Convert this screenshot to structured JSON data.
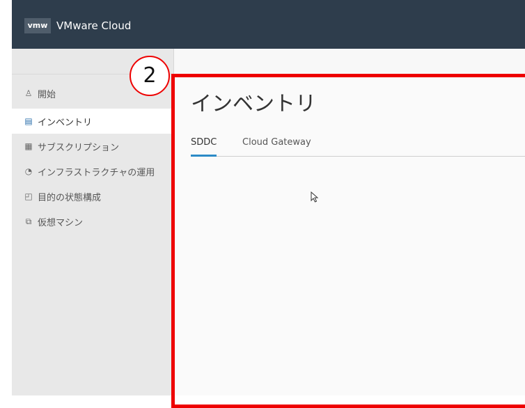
{
  "header": {
    "logo_text": "vmw",
    "app_title": "VMware Cloud"
  },
  "sidebar": {
    "items": [
      {
        "label": "開始",
        "icon": "user-icon"
      },
      {
        "label": "インベントリ",
        "icon": "inventory-icon",
        "active": true
      },
      {
        "label": "サブスクリプション",
        "icon": "calendar-icon"
      },
      {
        "label": "インフラストラクチャの運用",
        "icon": "gauge-icon"
      },
      {
        "label": "目的の状態構成",
        "icon": "config-icon"
      },
      {
        "label": "仮想マシン",
        "icon": "vm-icon"
      }
    ]
  },
  "main": {
    "title": "インベントリ",
    "tabs": [
      {
        "label": "SDDC",
        "active": true
      },
      {
        "label": "Cloud Gateway"
      }
    ]
  },
  "annotation": {
    "step_number": "2",
    "highlight_color": "#ee0000"
  },
  "colors": {
    "header_bg": "#2e3d4c",
    "accent": "#2b8ac7"
  }
}
